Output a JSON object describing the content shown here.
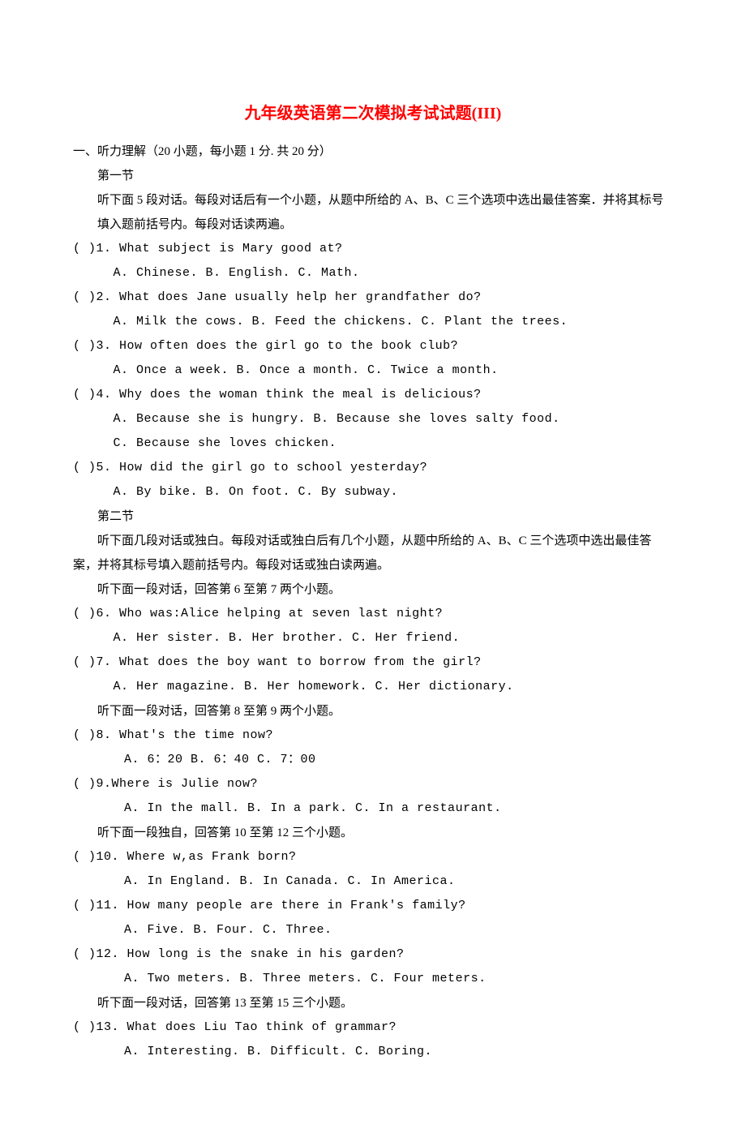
{
  "title": "九年级英语第二次模拟考试试题(III)",
  "sec1_heading": "一、听力理解（20 小题，每小题 1 分. 共 20 分）",
  "part1_label": "第一节",
  "part1_instruction": "听下面 5 段对话。每段对话后有一个小题，从题中所给的 A、B、C 三个选项中选出最佳答案．并将其标号填入题前括号内。每段对话读两遍。",
  "q1": "(     )1. What subject is Mary good at?",
  "q1_opts": "A. Chinese.       B. English.     C. Math.",
  "q2": "(     )2. What does Jane usually help her grandfather do?",
  "q2_opts": "A. Milk the cows.        B. Feed the chickens.  C. Plant the trees.",
  "q3": "(     )3. How often does the girl go to the book club?",
  "q3_opts": "A. Once a week.        B. Once a month.    C. Twice a month.",
  "q4": "(     )4. Why does the woman think the meal is delicious?",
  "q4_opts_a": "A.  Because she is hungry.       B.  Because she loves salty food.",
  "q4_opts_b": "C. Because she loves chicken.",
  "q5": "(     )5. How did the girl go to school yesterday?",
  "q5_opts": "A. By bike.       B. On foot.        C. By subway.",
  "part2_label": "第二节",
  "part2_instruction": "听下面几段对话或独白。每段对话或独白后有几个小题，从题中所给的 A、B、C 三个选项中选出最佳答案，并将其标号填入题前括号内。每段对话或独白读两遍。",
  "passage_6_7": "听下面一段对话，回答第 6 至第 7 两个小题。",
  "q6": "(     )6. Who was:Alice helping at seven last night?",
  "q6_opts": "A. Her sister.       B. Her brother.     C. Her friend.",
  "q7": "(     )7. What does the boy want to borrow from the girl?",
  "q7_opts": "A. Her magazine.         B. Her homework.    C.  Her dictionary.",
  "passage_8_9": "听下面一段对话，回答第 8 至第 9 两个小题。",
  "q8": "(     )8. What's the time now?",
  "q8_opts": "A. 6：20     B. 6：40     C. 7：00",
  "q9": "(     )9.Where is Julie now?",
  "q9_opts": "A. In the mall.    B. In a park.    C. In a restaurant.",
  "passage_10_12": "听下面一段独自，回答第 10 至第 12 三个小题。",
  "q10": "(     )10. Where w,as Frank born?",
  "q10_opts": "A. In England.     B. In Canada.        C. In America.",
  "q11": "(     )11. How many people are there in Frank's family?",
  "q11_opts": "A. Five.     B. Four.         C. Three.",
  "q12": "(     )12. How long is the snake in his garden?",
  "q12_opts": "A. Two meters.      B. Three meters.     C. Four meters.",
  "passage_13_15": "听下面一段对话，回答第 13 至第 15 三个小题。",
  "q13": "(     )13. What does Liu Tao think of grammar?",
  "q13_opts": "A. Interesting.    B. Difficult.        C. Boring."
}
